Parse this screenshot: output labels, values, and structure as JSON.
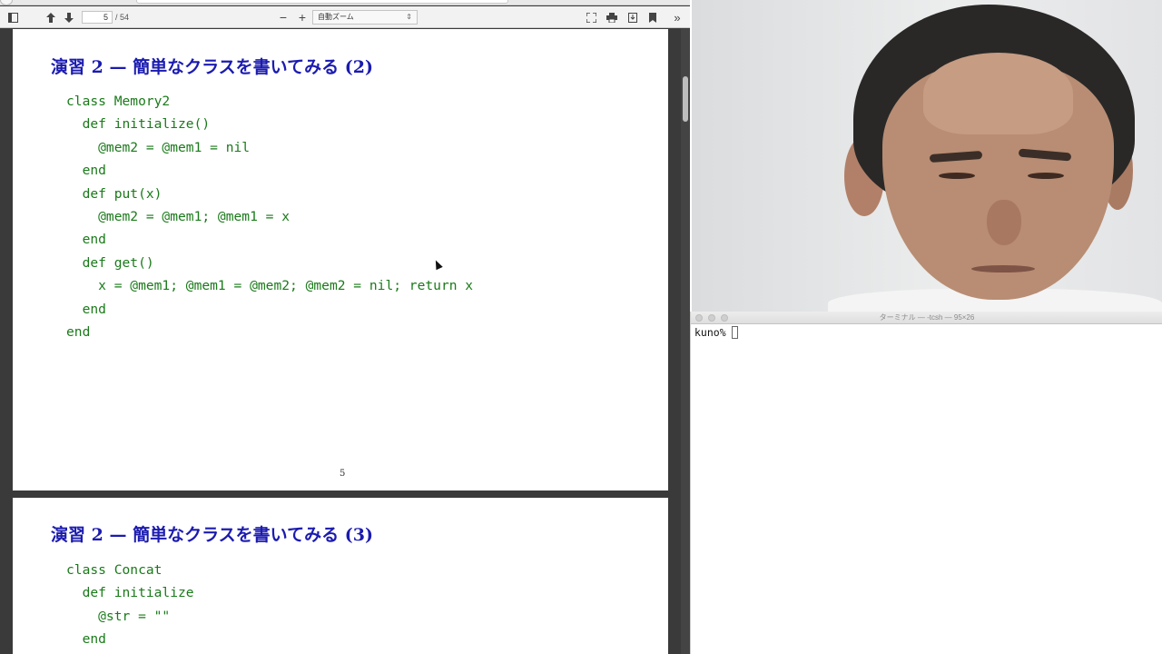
{
  "viewer": {
    "toolbar": {
      "page_current": "5",
      "page_count": "/ 54",
      "zoom_label": "自動ズーム",
      "icons": [
        "sidebar-toggle-icon",
        "arrow-up-icon",
        "arrow-down-icon",
        "zoom-out-icon",
        "zoom-in-icon",
        "fullscreen-icon",
        "print-icon",
        "download-icon",
        "bookmark-icon",
        "more-tools-icon"
      ]
    },
    "pages": [
      {
        "title": "演習 2 — 簡単なクラスを書いてみる (2)",
        "code": [
          "class Memory2",
          "  def initialize()",
          "    @mem2 = @mem1 = nil",
          "  end",
          "  def put(x)",
          "    @mem2 = @mem1; @mem1 = x",
          "  end",
          "  def get()",
          "    x = @mem1; @mem1 = @mem2; @mem2 = nil; return x",
          "  end",
          "end"
        ],
        "page_number": "5"
      },
      {
        "title": "演習 2 — 簡単なクラスを書いてみる (3)",
        "code": [
          "class Concat",
          "  def initialize",
          "    @str = \"\"",
          "  end"
        ]
      }
    ]
  },
  "terminal": {
    "title": "ターミナル — -tcsh — 95×26",
    "prompt": "kuno%"
  },
  "colors": {
    "title_blue": "#1b1bb0",
    "code_green": "#1a7a1a",
    "viewer_bg": "#3a3a3a"
  }
}
